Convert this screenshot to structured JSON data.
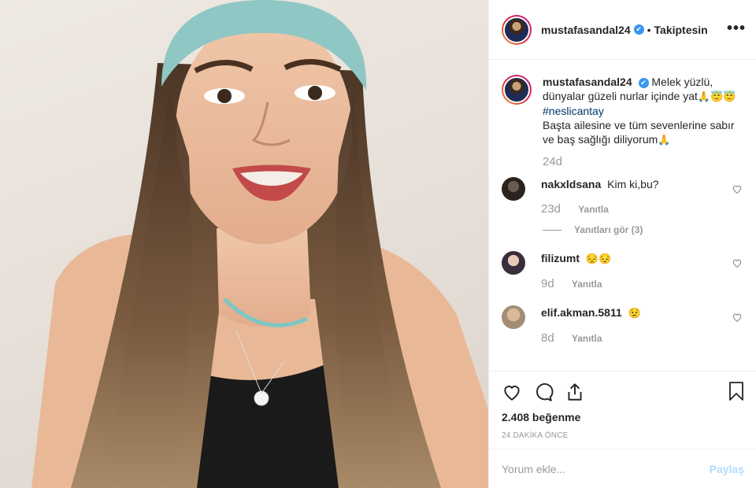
{
  "post": {
    "username": "mustafasandal24",
    "follow_status": "Takiptesin",
    "more_label": "•••"
  },
  "caption": {
    "username": "mustafasandal24",
    "text_line1": "Melek yüzlü, dünyalar güzeli nurlar içinde yat",
    "emojis1": "🙏😇😇",
    "hashtag": "#neslicantay",
    "text_line2": "Başta ailesine ve tüm sevenlerine sabır ve baş sağlığı diliyorum",
    "emojis2": "🙏",
    "time": "24d"
  },
  "comments": [
    {
      "username": "nakxldsana",
      "text": "Kim ki,bu?",
      "time": "23d",
      "reply_label": "Yanıtla",
      "view_replies": "Yanıtları gör (3)"
    },
    {
      "username": "filizumt",
      "text": "😔😔",
      "time": "9d",
      "reply_label": "Yanıtla"
    },
    {
      "username": "elif.akman.5811",
      "text": "😟",
      "time": "8d",
      "reply_label": "Yanıtla"
    }
  ],
  "likes": "2.408 beğenme",
  "posted_time": "24 DAKİKA ÖNCE",
  "add_comment": {
    "placeholder": "Yorum ekle...",
    "post_label": "Paylaş"
  },
  "icons": [
    "heart-icon",
    "comment-icon",
    "share-icon",
    "bookmark-icon",
    "more-icon",
    "verified-icon"
  ]
}
